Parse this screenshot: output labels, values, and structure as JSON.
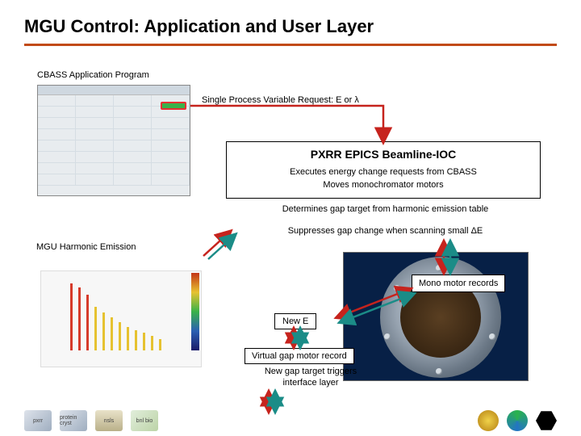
{
  "title": "MGU Control: Application and User Layer",
  "labels": {
    "app_program": "CBASS Application Program",
    "single_request": "Single Process Variable Request: E or λ",
    "harmonic": "MGU Harmonic Emission"
  },
  "pxrr": {
    "header": "PXRR EPICS Beamline-IOC",
    "line1": "Executes energy change requests from CBASS",
    "line2": "Moves monochromator motors"
  },
  "det": {
    "gap": "Determines gap target from harmonic emission table",
    "suppress": "Suppresses gap change when scanning small ΔE"
  },
  "boxes": {
    "mono": "Mono motor records",
    "newe": "New E",
    "vgap": "Virtual gap motor record",
    "trigger": "New gap target triggers interface layer"
  },
  "logos": {
    "a": "pxrr",
    "b": "protein cryst",
    "c": "nsls",
    "d": "bnl bio",
    "e": "bnl",
    "f": "nsls-ii",
    "g": "hex"
  }
}
